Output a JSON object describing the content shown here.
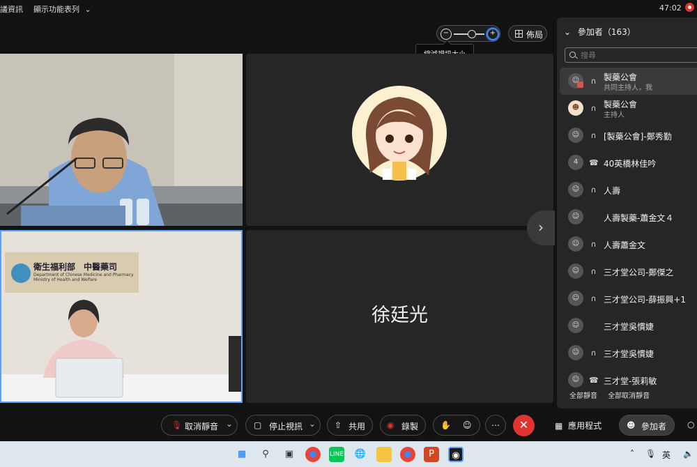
{
  "topbar": {
    "left_fragment": "議資訊",
    "view_menu": "顯示功能表列",
    "clock": "47:02"
  },
  "zoom": {
    "layout_label": "佈局",
    "tooltip": "縮減視訊大小"
  },
  "tiles": {
    "tile4_name": "徐廷光"
  },
  "panel": {
    "title": "參加者（163）",
    "search_placeholder": "搜尋",
    "participants": [
      {
        "name": "製藥公會",
        "role": "共同主持人，我",
        "avatar": "person-icon",
        "audio": "headset-icon"
      },
      {
        "name": "製藥公會",
        "role": "主持人",
        "avatar": "cartoon-avatar",
        "audio": "headset-icon"
      },
      {
        "name": "[製藥公會]-鄭秀勤",
        "role": "",
        "avatar": "person-icon",
        "audio": "headset-icon"
      },
      {
        "name": "40英橋林佳吟",
        "role": "",
        "avatar": "4",
        "audio": "phone-icon"
      },
      {
        "name": "人壽",
        "role": "",
        "avatar": "person-icon",
        "audio": "headset-icon"
      },
      {
        "name": "人壽製藥-蕭金文４",
        "role": "",
        "avatar": "person-icon",
        "audio": ""
      },
      {
        "name": "人壽蕭金文",
        "role": "",
        "avatar": "person-icon",
        "audio": "headset-icon"
      },
      {
        "name": "三才堂公司-鄭傑之",
        "role": "",
        "avatar": "person-icon",
        "audio": "headset-icon"
      },
      {
        "name": "三才堂公司-薛振興+1",
        "role": "",
        "avatar": "person-icon",
        "audio": "headset-icon"
      },
      {
        "name": "三才堂吳慣婕",
        "role": "",
        "avatar": "person-icon",
        "audio": ""
      },
      {
        "name": "三才堂吳慣婕",
        "role": "",
        "avatar": "person-icon",
        "audio": "headset-icon"
      },
      {
        "name": "三才堂-張莉敏",
        "role": "",
        "avatar": "person-icon",
        "audio": "phone-icon"
      }
    ],
    "mute_all": "全部靜音",
    "unmute_all": "全部取消靜音"
  },
  "tile3_sign": {
    "org": "衛生福利部　中醫藥司",
    "en1": "Department of Chinese Medicine and Pharmacy",
    "en2": "Ministry of Health and Welfare"
  },
  "toolbar": {
    "unmute": "取消靜音",
    "stop_video": "停止視訊",
    "share": "共用",
    "record": "錄製",
    "apps": "應用程式",
    "participants": "參加者"
  },
  "taskbar": {
    "lang": "英"
  },
  "colors": {
    "accent_blue": "#5aa0ff",
    "end_red": "#e0342e"
  }
}
